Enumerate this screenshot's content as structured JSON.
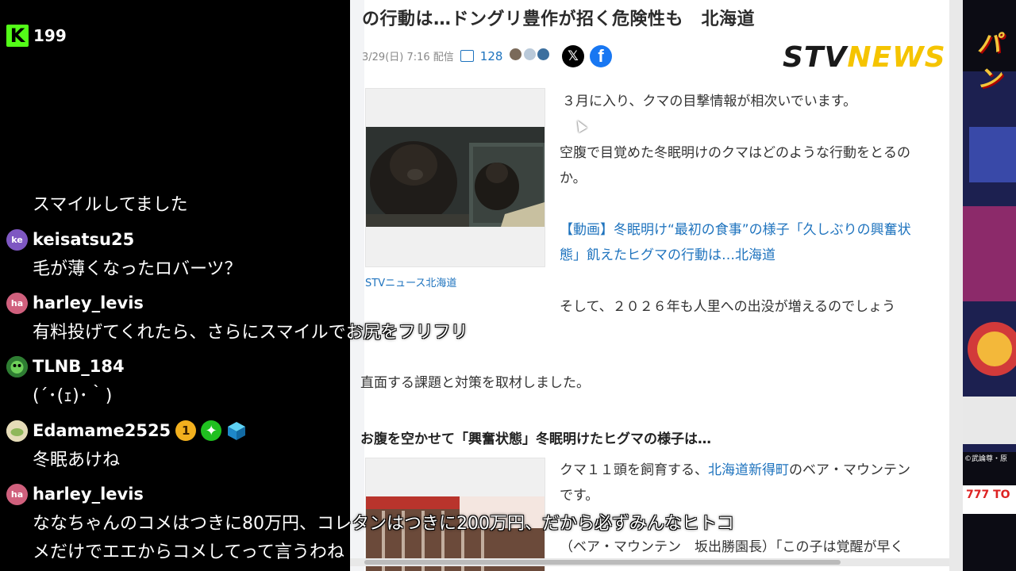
{
  "viewer_count": "199",
  "chat": [
    {
      "user": "",
      "text": "スマイルしてました",
      "avatar": ""
    },
    {
      "user": "keisatsu25",
      "text": "毛が薄くなったロバーツ？",
      "avatar": "ke"
    },
    {
      "user": "harley_levis",
      "text": "有料投げてくれたら、さらにスマイルでお尻をフリフリ",
      "avatar": "ha"
    },
    {
      "user": "TLNB_184",
      "text": "(´･(ｪ)･｀)",
      "avatar": ""
    },
    {
      "user": "Edamame2525",
      "text": "冬眠あけね",
      "avatar": ""
    },
    {
      "user": "harley_levis",
      "text": "ななちゃんのコメはつきに80万円、コレタンはつきに200万円、だから必ずみんなヒトコ",
      "text2": "メだけでエエからコメしてって言うわね",
      "avatar": "ha"
    }
  ],
  "badge_1": "1",
  "article": {
    "title": "の行動は…ドングリ豊作が招く危険性も　北海道",
    "date": "3/29(日) 7:16 配信",
    "comment_count": "128",
    "share_x": "𝕏",
    "share_fb": "f",
    "brand_1": "STV",
    "brand_2": "NEWS",
    "caption": "STVニュース北海道",
    "p1": "３月に入り、クマの目撃情報が相次いでいます。",
    "p2a": "空腹で目覚めた冬眠明けのクマはどのような行動をとるの",
    "p2b": "か。",
    "link_a": "【動画】冬眠明け“最初の食事”の様子「久しぶりの興奮状",
    "link_b": "態」飢えたヒグマの行動は…北海道",
    "p3": "そして、２０２６年も人里への出没が増えるのでしょう",
    "p4": "直面する課題と対策を取材しました。",
    "h2": "お腹を空かせて「興奮状態」冬眠明けたヒグマの様子は…",
    "p5a_pre": "クマ１１頭を飼育する、",
    "p5a_link": "北海道新得町",
    "p5a_post": "のベア・マウンテン",
    "p5b": "です。",
    "p6": "（ベア・マウンテン　坂出勝園長）「この子は覚醒が早く"
  },
  "ad_text": "パン",
  "ad_copyright": "©武論尊・原",
  "ad_logo": "777 TO"
}
